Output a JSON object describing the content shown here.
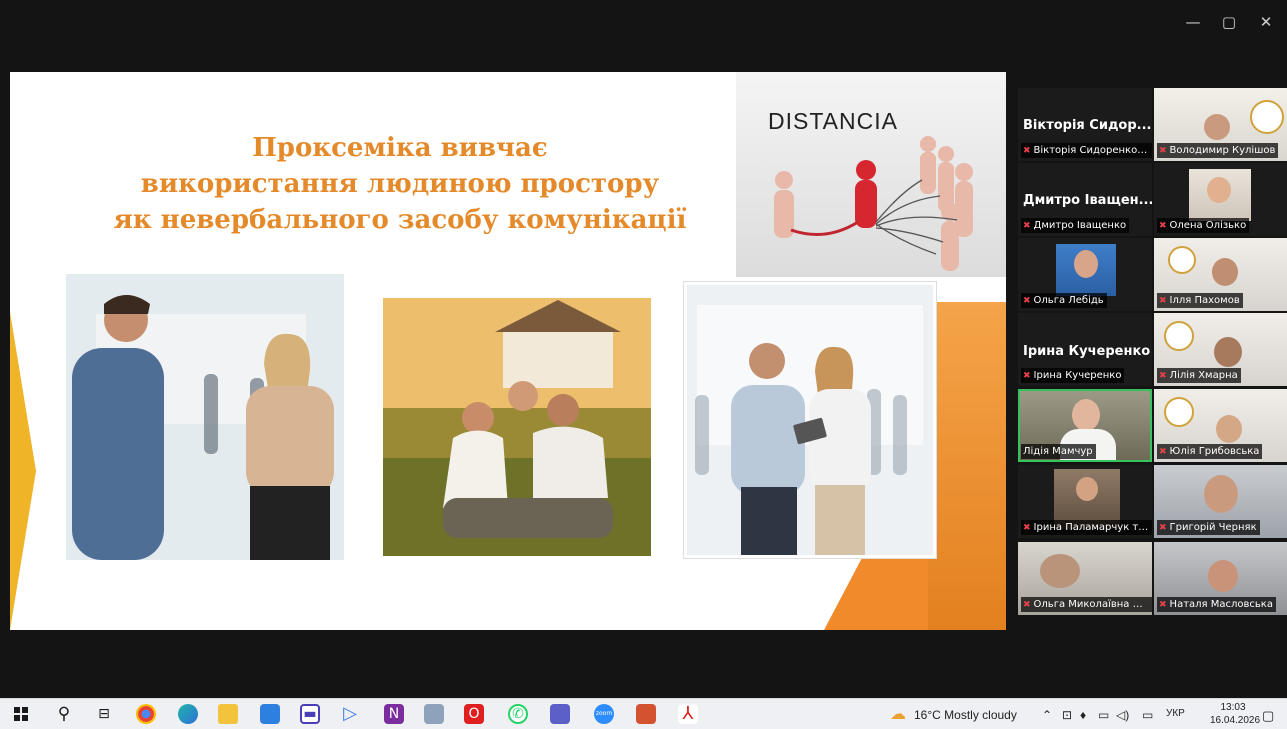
{
  "window": {
    "minimize_label": "—",
    "restore_label": "▢",
    "close_label": "✕"
  },
  "slide": {
    "title_lines": [
      "Проксеміка вивчає",
      "використання людиною простору",
      "як невербального засобу комунікації"
    ],
    "image_caption": "DISTANCIA"
  },
  "participants": {
    "vsydorenko": {
      "bigname": "Вікторія Сидор...",
      "label": "Вікторія Сидоренко Бі..."
    },
    "kulishov": {
      "label": "Володимир Кулішов"
    },
    "ivashchenko": {
      "bigname": "Дмитро Іващен...",
      "label": "Дмитро Іващенко"
    },
    "olizko": {
      "label": "Олена Олізько"
    },
    "lebid": {
      "label": "Ольга Лебідь"
    },
    "pakhomov": {
      "label": "Ілля Пахомов"
    },
    "kucherenko": {
      "bigname": "Ірина Кучеренко",
      "label": "Ірина Кучеренко"
    },
    "khmarna": {
      "label": "Лілія Хмарна"
    },
    "mamchur": {
      "label": "Лідія Мамчур"
    },
    "hrybovska": {
      "label": "Юлія Грибовська"
    },
    "palamarchuk": {
      "label": "Ірина Паламарчук та ..."
    },
    "cherniak": {
      "label": "Григорій Черняк"
    },
    "olga_mb": {
      "label": "Ольга Миколаївна Ба..."
    },
    "maslovska": {
      "label": "Наталя Масловська"
    }
  },
  "taskbar": {
    "weather": "16°C  Mostly cloudy",
    "language": "УКР",
    "time": "13:03",
    "date": "16.04.2026",
    "icons": [
      "windows-start-icon",
      "search-icon",
      "task-view-icon",
      "chrome-icon",
      "edge-icon",
      "file-explorer-icon",
      "mail-icon",
      "save-icon",
      "media-player-icon",
      "onenote-icon",
      "news-icon",
      "opera-icon",
      "whatsapp-icon",
      "teams-icon",
      "zoom-icon",
      "powerpoint-icon",
      "acrobat-icon"
    ]
  },
  "colors": {
    "title_orange": "#e48a2a",
    "active_speaker": "#36c35c",
    "muted_mic": "#e6404a"
  }
}
